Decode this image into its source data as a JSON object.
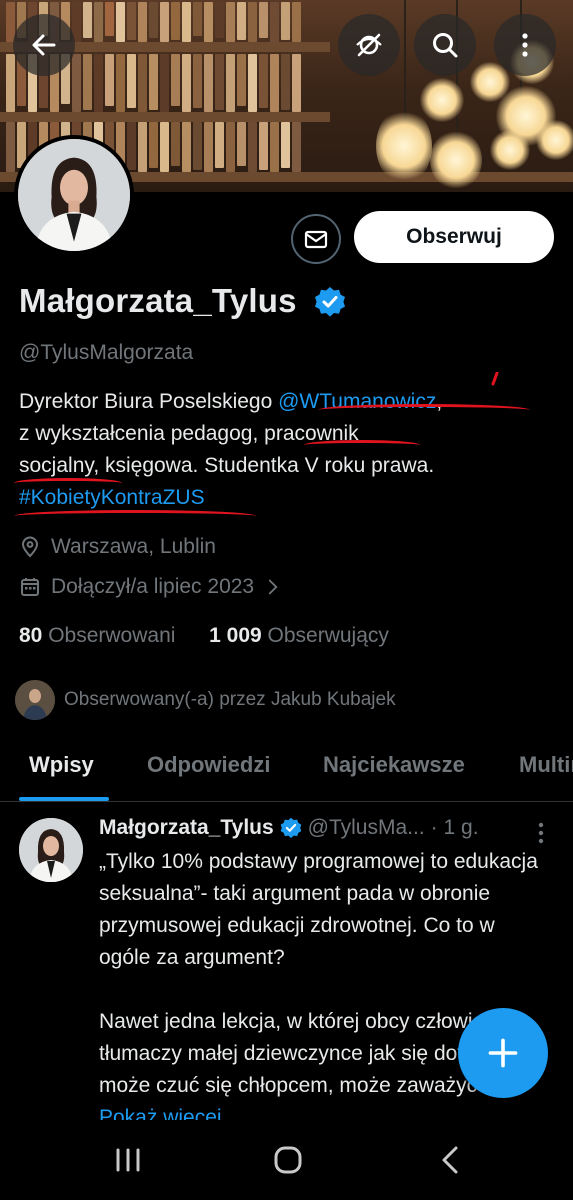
{
  "top_actions": {
    "back_icon": "arrow-left-icon",
    "hide_icon": "eye-slash-icon",
    "search_icon": "search-icon",
    "more_icon": "more-vertical-icon"
  },
  "profile": {
    "display_name": "Małgorzata_Tylus",
    "handle": "@TylusMalgorzata",
    "follow_label": "Obserwuj",
    "bio": {
      "p1": "Dyrektor Biura Poselskiego ",
      "mention": "@WTumanowicz",
      "p2": ",",
      "p3": "z wykształcenia pedagog, ",
      "p4": "pracownik",
      "p5": "socjalny",
      "p6": ", księgowa. Studentka V roku prawa.",
      "hashtag": "#KobietyKontraZUS"
    },
    "location": "Warszawa, Lublin",
    "joined": "Dołączył/a lipiec 2023",
    "following_count": "80",
    "following_label": "Obserwowani",
    "followers_count": "1 009",
    "followers_label": "Obserwujący",
    "followed_by": "Obserwowany(-a) przez Jakub Kubajek"
  },
  "tabs": [
    "Wpisy",
    "Odpowiedzi",
    "Najciekawsze",
    "Multimedia"
  ],
  "active_tab": "Wpisy",
  "tweet": {
    "name": "Małgorzata_Tylus",
    "handle": "@TylusMa...",
    "time": "· 1 g.",
    "text_1": "„Tylko 10% podstawy programowej to edukacja seksualna”- taki argument pada w obronie przymusowej edukacji zdrowotnej. Co to w ogóle za argument?",
    "text_2": "Nawet jedna lekcja, w której obcy człowiek tłumaczy małej dziewczynce jak się dotykać i że może czuć się chłopcem, może zaważyć na ",
    "show_more": "Pokaż więcej"
  },
  "colors": {
    "accent": "#1d9bf0",
    "background": "#000000",
    "secondary_text": "#71767b",
    "annotation_red": "#e0141e"
  }
}
